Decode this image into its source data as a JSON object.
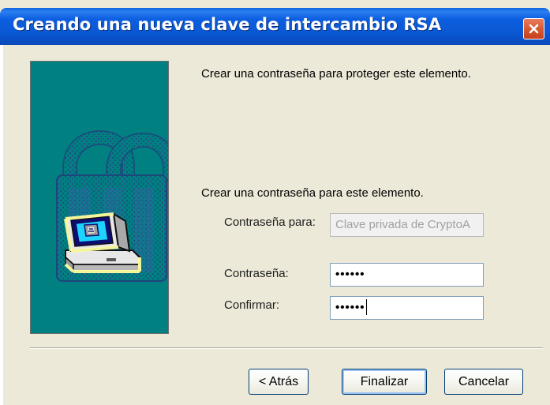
{
  "window": {
    "title": "Creando una nueva clave de intercambio RSA",
    "close_icon": "close-icon"
  },
  "content": {
    "intro_text": "Crear una contraseña para proteger este elemento.",
    "section_heading": "Crear una contraseña para este elemento.",
    "password_for_label": "Contraseña para:",
    "password_for_value": "Clave privada de CryptoA",
    "password_label": "Contraseña:",
    "password_value": "••••••",
    "confirm_label": "Confirmar:",
    "confirm_value": "••••••"
  },
  "buttons": {
    "back": "< Atrás",
    "finish": "Finalizar",
    "cancel": "Cancelar"
  },
  "colors": {
    "title_bar": "#0a57d2",
    "dialog_bg": "#ece9d8",
    "hero_bg": "#008080",
    "close_button": "#d85a34"
  },
  "icons": {
    "hero_icon": "security-computer-lock-icon"
  }
}
